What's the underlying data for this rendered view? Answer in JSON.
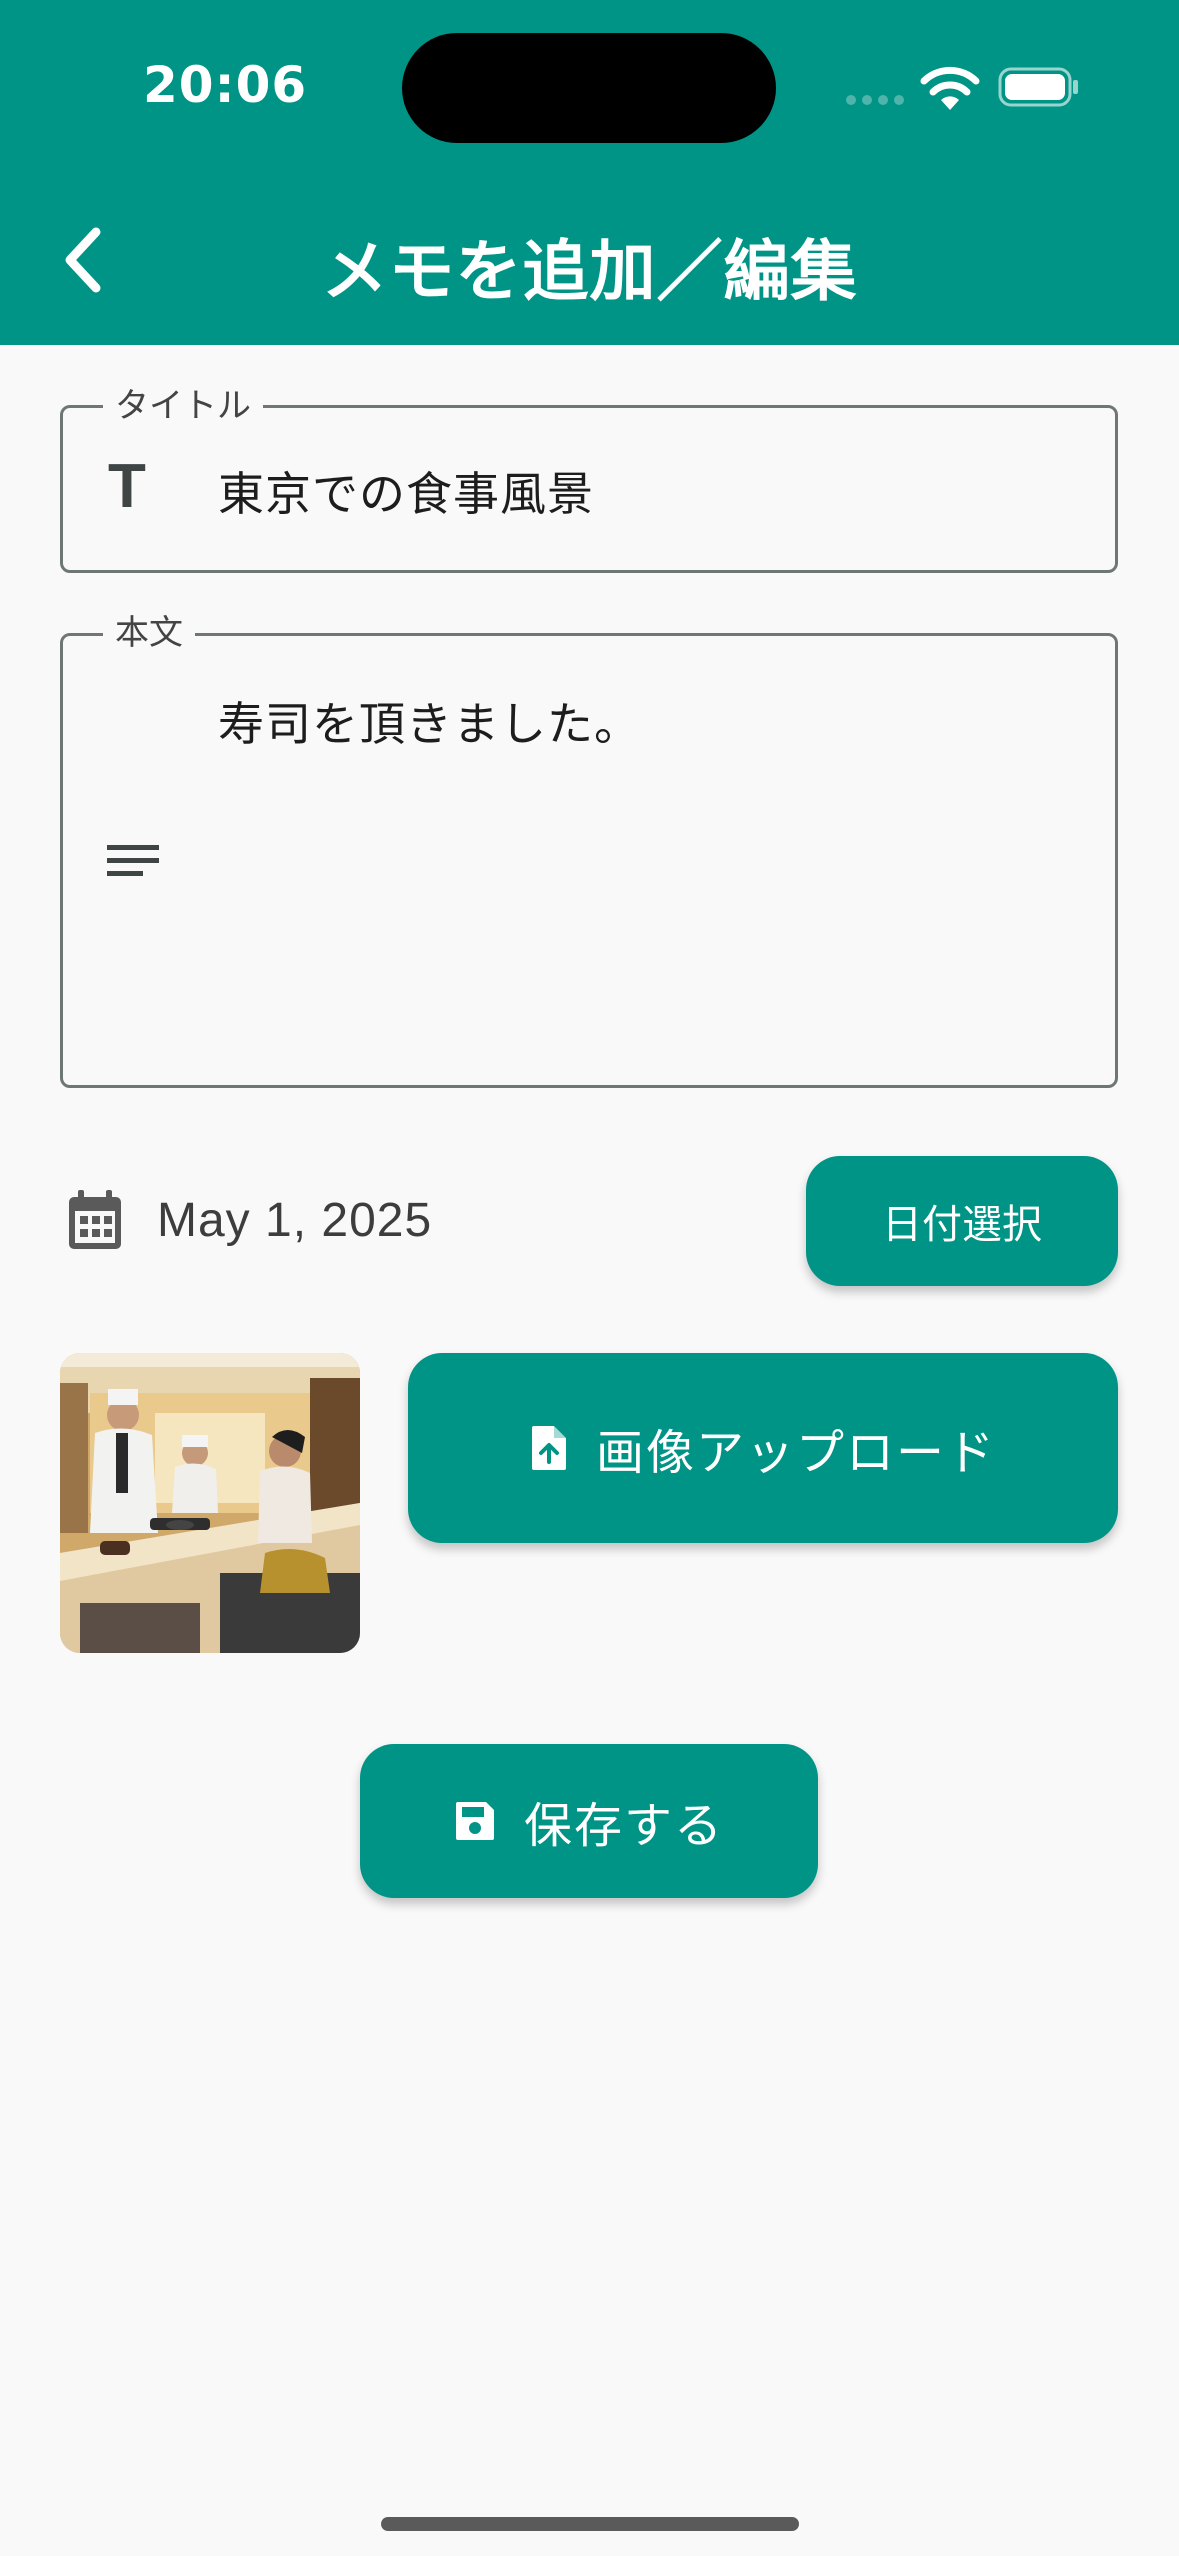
{
  "status_bar": {
    "time": "20:06"
  },
  "app_bar": {
    "title": "メモを追加／編集",
    "back_icon": "chevron-left-icon"
  },
  "form": {
    "title_field": {
      "label": "タイトル",
      "value": "東京での食事風景",
      "icon": "T"
    },
    "body_field": {
      "label": "本文",
      "value": "寿司を頂きました。",
      "icon": "notes-lines-icon"
    }
  },
  "date": {
    "value": "May 1, 2025",
    "button_label": "日付選択",
    "icon": "calendar-icon"
  },
  "image": {
    "upload_label": "画像アップロード",
    "upload_icon": "file-upload-icon",
    "thumbnail": "sushi-restaurant-photo"
  },
  "save": {
    "label": "保存する",
    "icon": "save-icon"
  },
  "colors": {
    "primary": "#009486",
    "background": "#f9f9f9",
    "outline": "#6f7774"
  }
}
